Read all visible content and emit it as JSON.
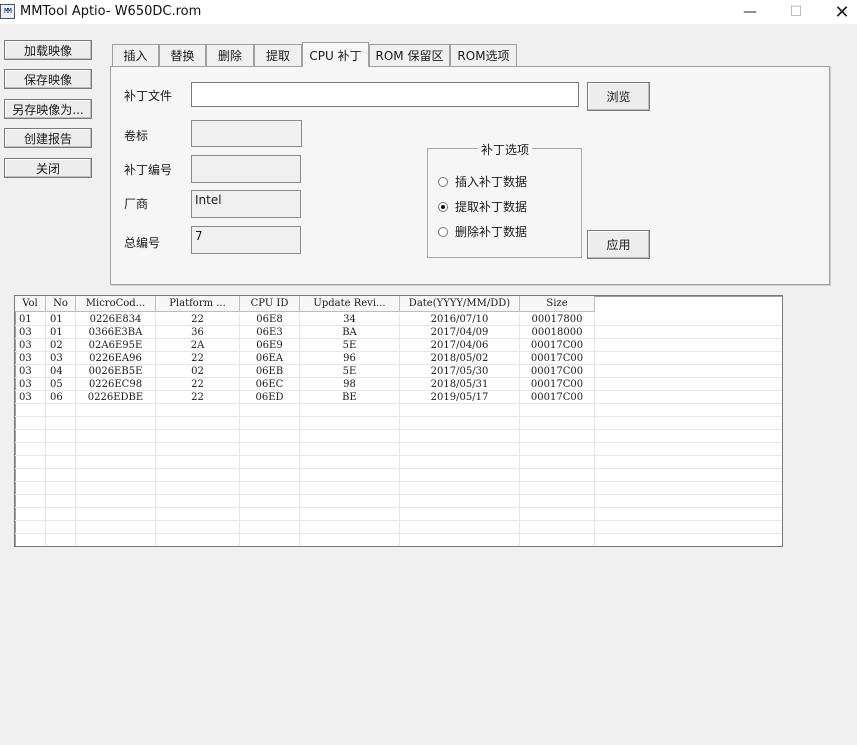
{
  "window": {
    "title": "MMTool Aptio- W650DC.rom",
    "icon_text": "MM",
    "controls": {
      "minimize": "—",
      "maximize": "☐",
      "close": "✕"
    }
  },
  "left_buttons": {
    "load": "加载映像",
    "save": "保存映像",
    "save_as": "另存映像为...",
    "report": "创建报告",
    "close": "关闭"
  },
  "tabs": [
    "插入",
    "替换",
    "删除",
    "提取",
    "CPU 补丁",
    "ROM 保留区",
    "ROM选项"
  ],
  "active_tab": "CPU 补丁",
  "patch_form": {
    "file_label": "补丁文件",
    "file_value": "",
    "browse": "浏览",
    "volume_label": "卷标",
    "volume_value": "",
    "patch_no_label": "补丁编号",
    "patch_no_value": "",
    "vendor_label": "厂商",
    "vendor_value": "Intel",
    "total_label": "总编号",
    "total_value": "7",
    "apply": "应用"
  },
  "patch_options": {
    "title": "补丁选项",
    "options": [
      "插入补丁数据",
      "提取补丁数据",
      "删除补丁数据"
    ],
    "selected": "提取补丁数据"
  },
  "table": {
    "columns": [
      "Vol",
      "No",
      "MicroCod...",
      "Platform ...",
      "CPU ID",
      "Update Revi...",
      "Date(YYYY/MM/DD)",
      "Size"
    ],
    "rows": [
      [
        "01",
        "01",
        "0226E834",
        "22",
        "06E8",
        "34",
        "2016/07/10",
        "00017800"
      ],
      [
        "03",
        "01",
        "0366E3BA",
        "36",
        "06E3",
        "BA",
        "2017/04/09",
        "00018000"
      ],
      [
        "03",
        "02",
        "02A6E95E",
        "2A",
        "06E9",
        "5E",
        "2017/04/06",
        "00017C00"
      ],
      [
        "03",
        "03",
        "0226EA96",
        "22",
        "06EA",
        "96",
        "2018/05/02",
        "00017C00"
      ],
      [
        "03",
        "04",
        "0026EB5E",
        "02",
        "06EB",
        "5E",
        "2017/05/30",
        "00017C00"
      ],
      [
        "03",
        "05",
        "0226EC98",
        "22",
        "06EC",
        "98",
        "2018/05/31",
        "00017C00"
      ],
      [
        "03",
        "06",
        "0226EDBE",
        "22",
        "06ED",
        "BE",
        "2019/05/17",
        "00017C00"
      ]
    ]
  }
}
